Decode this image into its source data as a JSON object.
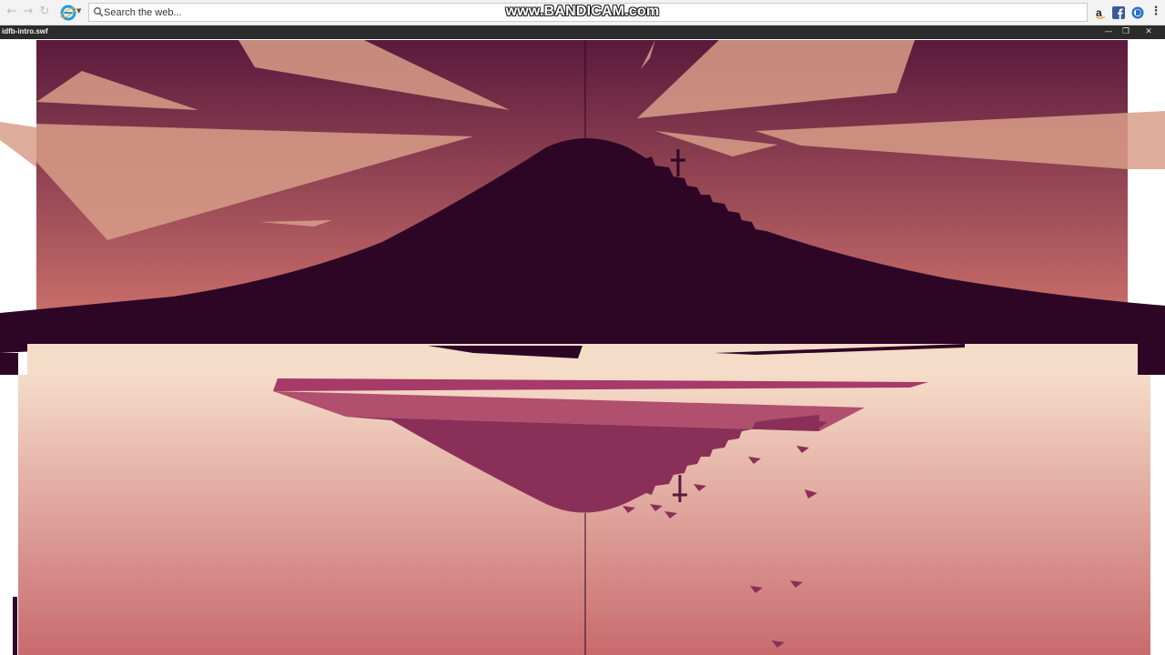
{
  "browser": {
    "search": {
      "placeholder": "Search the web..."
    },
    "icons": [
      "back-arrow-icon",
      "forward-arrow-icon",
      "refresh-icon",
      "ie-logo-icon",
      "search-icon",
      "amazon-icon",
      "facebook-icon",
      "ebay-icon",
      "menu-icon"
    ]
  },
  "watermark": "www.BANDICAM.com",
  "player": {
    "title": "idfb-intro.swf",
    "controls": [
      "minimize-icon",
      "restore-icon",
      "close-icon"
    ]
  },
  "scene": {
    "colors": {
      "sky_top": "#5a1a3c",
      "sky_horizon": "#c96e6a",
      "mountain": "#2d0626",
      "water_light": "#f5dcc8",
      "water_dark": "#c86a6e",
      "reflection": "#8a3058",
      "ray": "#d89e88"
    }
  }
}
